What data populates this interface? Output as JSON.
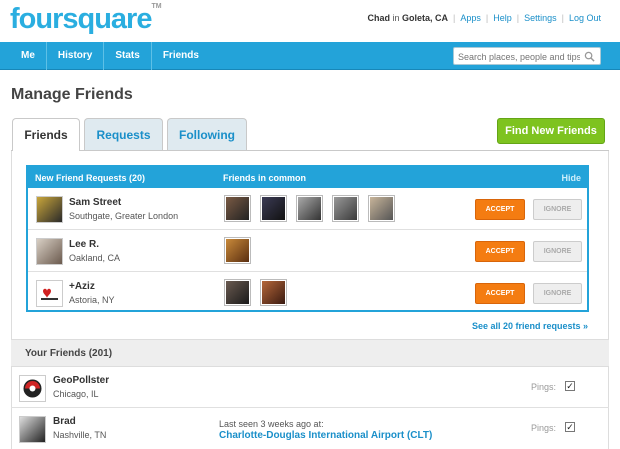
{
  "brand": {
    "name": "foursquare",
    "tm": "TM"
  },
  "toplinks": {
    "user": "Chad",
    "in": "in",
    "city": "Goleta, CA",
    "links": [
      "Apps",
      "Help",
      "Settings",
      "Log Out"
    ]
  },
  "nav": {
    "items": [
      "Me",
      "History",
      "Stats",
      "Friends"
    ]
  },
  "search": {
    "placeholder": "Search places, people and tips",
    "icon": "magnifier-icon"
  },
  "page": {
    "title": "Manage Friends"
  },
  "tabs": [
    "Friends",
    "Requests",
    "Following"
  ],
  "find_button": "Find New Friends",
  "requests": {
    "header": "New Friend Requests (20)",
    "common_header": "Friends in common",
    "hide": "Hide",
    "accept_label": "ACCEPT",
    "ignore_label": "IGNORE",
    "rows": [
      {
        "name": "Sam Street",
        "location": "Southgate, Greater London"
      },
      {
        "name": "Lee R.",
        "location": "Oakland, CA"
      },
      {
        "name": "+Aziz",
        "location": "Astoria, NY"
      }
    ],
    "see_all": "See all 20 friend requests »"
  },
  "friends": {
    "header": "Your Friends (201)",
    "pings_label": "Pings:",
    "rows": [
      {
        "name": "GeoPollster",
        "location": "Chicago, IL",
        "last_seen": "",
        "venue": ""
      },
      {
        "name": "Brad",
        "location": "Nashville, TN",
        "last_seen": "Last seen 3 weeks ago at:",
        "venue": "Charlotte-Douglas International Airport (CLT)"
      }
    ]
  },
  "colors": {
    "brand_blue": "#23a3d9",
    "accept_orange": "#f47c11",
    "find_green": "#7ec31f",
    "link_blue": "#1a8fc9"
  }
}
